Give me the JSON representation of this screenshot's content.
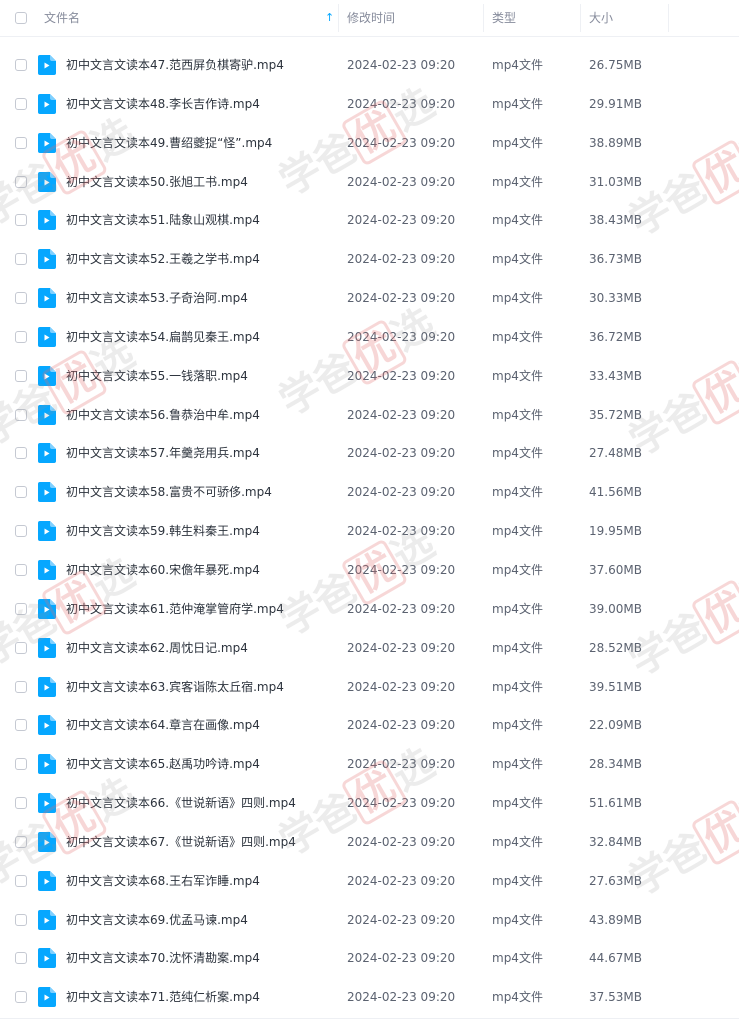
{
  "header": {
    "name": "文件名",
    "modified": "修改时间",
    "type": "类型",
    "size": "大小",
    "sort_icon": "↑"
  },
  "colors": {
    "accent": "#06a7ff",
    "video_icon": "#06a7ff"
  },
  "file_icon": "video-file-icon",
  "files": [
    {
      "name": "初中文言文读本47.范西屏负棋寄驴.mp4",
      "time": "2024-02-23 09:20",
      "type": "mp4文件",
      "size": "26.75MB"
    },
    {
      "name": "初中文言文读本48.李长吉作诗.mp4",
      "time": "2024-02-23 09:20",
      "type": "mp4文件",
      "size": "29.91MB"
    },
    {
      "name": "初中文言文读本49.曹绍夔捉“怪”.mp4",
      "time": "2024-02-23 09:20",
      "type": "mp4文件",
      "size": "38.89MB"
    },
    {
      "name": "初中文言文读本50.张旭工书.mp4",
      "time": "2024-02-23 09:20",
      "type": "mp4文件",
      "size": "31.03MB"
    },
    {
      "name": "初中文言文读本51.陆象山观棋.mp4",
      "time": "2024-02-23 09:20",
      "type": "mp4文件",
      "size": "38.43MB"
    },
    {
      "name": "初中文言文读本52.王羲之学书.mp4",
      "time": "2024-02-23 09:20",
      "type": "mp4文件",
      "size": "36.73MB"
    },
    {
      "name": "初中文言文读本53.子奇治阿.mp4",
      "time": "2024-02-23 09:20",
      "type": "mp4文件",
      "size": "30.33MB"
    },
    {
      "name": "初中文言文读本54.扁鹊见秦王.mp4",
      "time": "2024-02-23 09:20",
      "type": "mp4文件",
      "size": "36.72MB"
    },
    {
      "name": "初中文言文读本55.一钱落职.mp4",
      "time": "2024-02-23 09:20",
      "type": "mp4文件",
      "size": "33.43MB"
    },
    {
      "name": "初中文言文读本56.鲁恭治中牟.mp4",
      "time": "2024-02-23 09:20",
      "type": "mp4文件",
      "size": "35.72MB"
    },
    {
      "name": "初中文言文读本57.年羹尧用兵.mp4",
      "time": "2024-02-23 09:20",
      "type": "mp4文件",
      "size": "27.48MB"
    },
    {
      "name": "初中文言文读本58.富贵不可骄侈.mp4",
      "time": "2024-02-23 09:20",
      "type": "mp4文件",
      "size": "41.56MB"
    },
    {
      "name": "初中文言文读本59.韩生料秦王.mp4",
      "time": "2024-02-23 09:20",
      "type": "mp4文件",
      "size": "19.95MB"
    },
    {
      "name": "初中文言文读本60.宋儋年暴死.mp4",
      "time": "2024-02-23 09:20",
      "type": "mp4文件",
      "size": "37.60MB"
    },
    {
      "name": "初中文言文读本61.范仲淹掌管府学.mp4",
      "time": "2024-02-23 09:20",
      "type": "mp4文件",
      "size": "39.00MB"
    },
    {
      "name": "初中文言文读本62.周忱日记.mp4",
      "time": "2024-02-23 09:20",
      "type": "mp4文件",
      "size": "28.52MB"
    },
    {
      "name": "初中文言文读本63.宾客诣陈太丘宿.mp4",
      "time": "2024-02-23 09:20",
      "type": "mp4文件",
      "size": "39.51MB"
    },
    {
      "name": "初中文言文读本64.章言在画像.mp4",
      "time": "2024-02-23 09:20",
      "type": "mp4文件",
      "size": "22.09MB"
    },
    {
      "name": "初中文言文读本65.赵禹功吟诗.mp4",
      "time": "2024-02-23 09:20",
      "type": "mp4文件",
      "size": "28.34MB"
    },
    {
      "name": "初中文言文读本66.《世说新语》四则.mp4",
      "time": "2024-02-23 09:20",
      "type": "mp4文件",
      "size": "51.61MB"
    },
    {
      "name": "初中文言文读本67.《世说新语》四则.mp4",
      "time": "2024-02-23 09:20",
      "type": "mp4文件",
      "size": "32.84MB"
    },
    {
      "name": "初中文言文读本68.王右军诈睡.mp4",
      "time": "2024-02-23 09:20",
      "type": "mp4文件",
      "size": "27.63MB"
    },
    {
      "name": "初中文言文读本69.优孟马谏.mp4",
      "time": "2024-02-23 09:20",
      "type": "mp4文件",
      "size": "43.89MB"
    },
    {
      "name": "初中文言文读本70.沈怀清勘案.mp4",
      "time": "2024-02-23 09:20",
      "type": "mp4文件",
      "size": "44.67MB"
    },
    {
      "name": "初中文言文读本71.范纯仁析案.mp4",
      "time": "2024-02-23 09:20",
      "type": "mp4文件",
      "size": "37.53MB"
    }
  ],
  "watermark": {
    "pre": "学爸",
    "boxed": "优",
    "post": "选"
  }
}
